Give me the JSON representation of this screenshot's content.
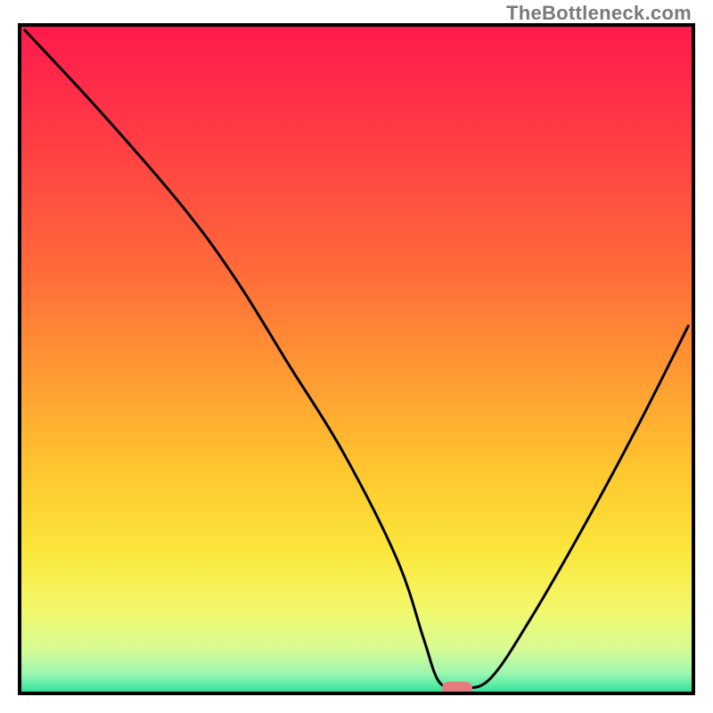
{
  "watermark": "TheBottleneck.com",
  "colors": {
    "border": "#000000",
    "curve": "#000000",
    "marker": "#e77a7d",
    "gradient_stops": [
      {
        "offset": 0.0,
        "color": "#ff1a4d"
      },
      {
        "offset": 0.18,
        "color": "#ff3f44"
      },
      {
        "offset": 0.36,
        "color": "#ff6a3a"
      },
      {
        "offset": 0.52,
        "color": "#ff9a33"
      },
      {
        "offset": 0.66,
        "color": "#ffc62f"
      },
      {
        "offset": 0.78,
        "color": "#fbe63a"
      },
      {
        "offset": 0.87,
        "color": "#f2f86b"
      },
      {
        "offset": 0.93,
        "color": "#d6fb95"
      },
      {
        "offset": 0.965,
        "color": "#9cf6b0"
      },
      {
        "offset": 0.985,
        "color": "#4fe9a2"
      },
      {
        "offset": 1.0,
        "color": "#18d993"
      }
    ]
  },
  "plot": {
    "inner_width": 752,
    "inner_height": 746
  },
  "chart_data": {
    "type": "line",
    "title": "",
    "xlabel": "",
    "ylabel": "",
    "xlim": [
      0,
      100
    ],
    "ylim": [
      0,
      100
    ],
    "x": [
      0,
      12,
      24,
      32,
      40,
      48,
      56,
      60,
      62,
      64,
      66,
      70,
      76,
      84,
      92,
      100
    ],
    "values": [
      100,
      87,
      73,
      62,
      49,
      36,
      20,
      8,
      2,
      0,
      0,
      2,
      11,
      25,
      40,
      55
    ],
    "marker": {
      "x": 65,
      "y": 0
    },
    "annotations": []
  }
}
